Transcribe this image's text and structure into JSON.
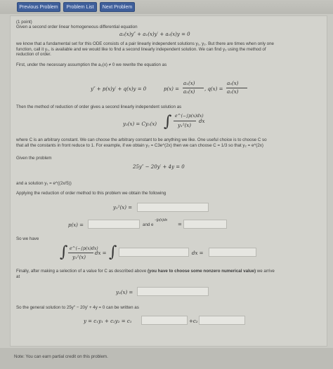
{
  "nav": {
    "previous": "Previous Problem",
    "list": "Problem List",
    "next": "Next Problem"
  },
  "problem": {
    "points": "(1 point)",
    "intro": "Given a second order linear homogeneous differential equation",
    "eq1": "a₂(x)y″ + a₁(x)y′ + a₀(x)y = 0",
    "p1_line1": "we know that a fundamental set for this ODE consists of a pair linearly independent solutions y₁, y₂. But there are times when only one",
    "p1_line2": "function, call it y₁, is available and we would like to find a second linearly independent solution. We can find y₂ using the method of",
    "p1_line3": "reduction of order.",
    "p2": "First, under the necessary assumption the a₂(x) ≠ 0 we rewrite the equation as",
    "eq2_left": "y″ + p(x)y′ + q(x)y = 0",
    "eq2_p": "p(x) =",
    "eq2_p_num": "a₁(x)",
    "eq2_p_den": "a₂(x)",
    "eq2_q": ",  q(x) =",
    "eq2_q_num": "a₀(x)",
    "eq2_q_den": "a₂(x)",
    "p3": "Then the method of reduction of order gives a second linearly independent solution as",
    "eq3_left": "y₂(x) = Cy₁(x)",
    "eq3_num": "e^(−∫p(x)dx)",
    "eq3_den": "y₁²(x)",
    "eq3_dx": "dx",
    "p4_line1": "where C is an arbitrary constant. We can choose the arbitrary constant to be anything we like. One useful choice is to choose C so",
    "p4_line2": "that all the constants in front reduce to 1. For example, if we obtain y₂ = C3e^(2x) then we can choose C = 1/3 so that y₂ = e^(2x)",
    "given_label": "Given the problem",
    "eq4": "25y″ − 20y′ + 4y = 0",
    "solution_label": "and a solution y₁ = e^((2x/5))",
    "apply_label": "Applying the reduction of order method to this problem we obtain the following",
    "y1sq_label": "y₁²(x) =",
    "px_label": "p(x) =",
    "and_label": "and e",
    "and_exp": "−∫p(x)dx",
    "eq_sign": "=",
    "sowe_label": "So we have",
    "int_num": "e^(−∫p(x)dx)",
    "int_den": "y₁²(x)",
    "int_dx": "dx =",
    "int_dx2": "dx =",
    "finally_line1_pre": "Finally, after making a selection of a value for C as described above ",
    "finally_bold": "(you have to choose some nonzero numerical value)",
    "finally_line1_post": " we arrive",
    "finally_line2": "at",
    "y2_label": "y₂(x) =",
    "general_label": "So the general solution to 25y″ − 20y′ + 4y = 0 can be written as",
    "general_eq": "y = c₁y₁ + c₂y₂ = c₁",
    "general_c2": "+c₂",
    "note": "Note: You can earn partial credit on this problem."
  }
}
